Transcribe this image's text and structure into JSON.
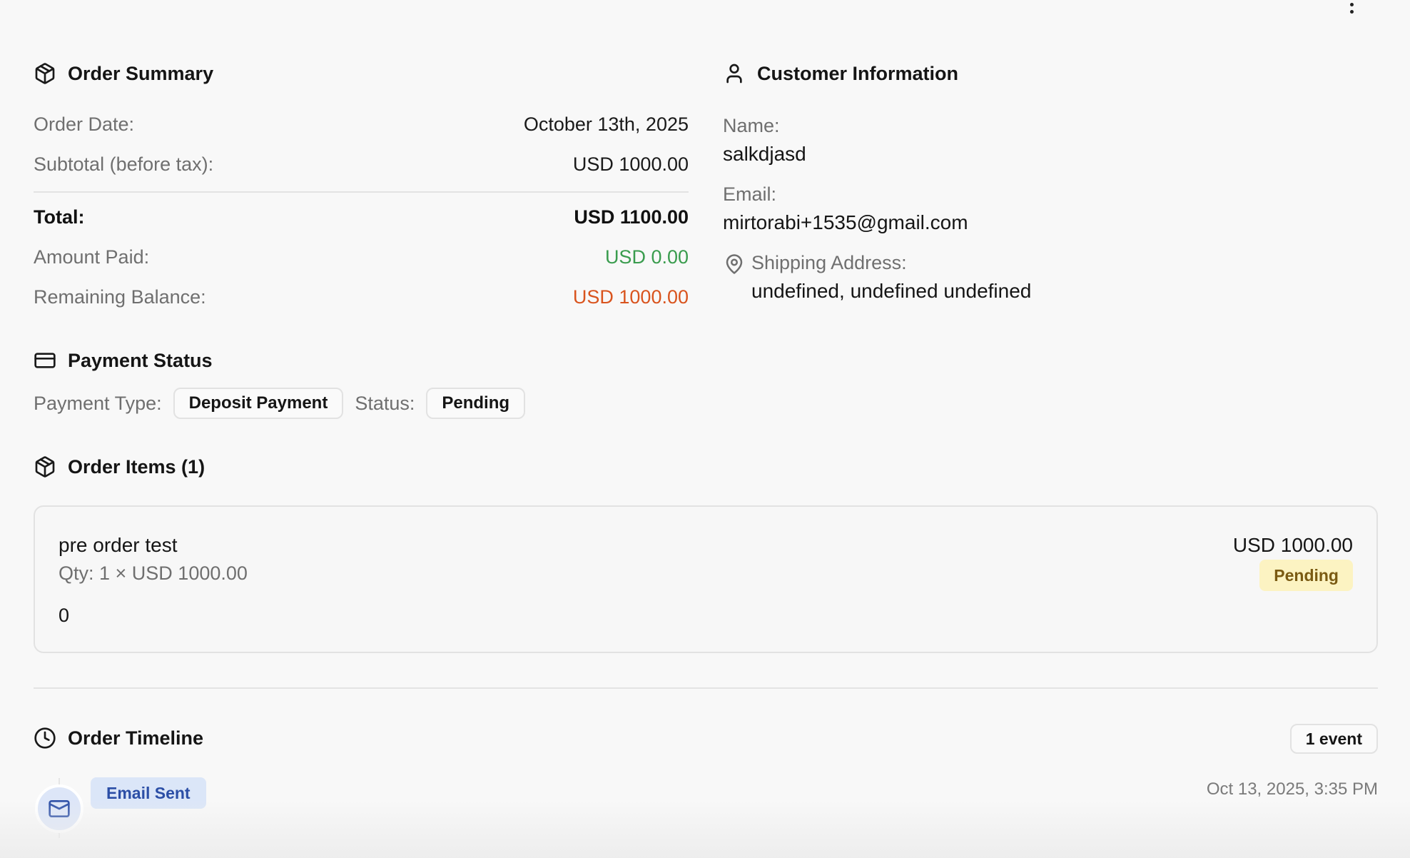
{
  "menu": {
    "icon": "more-vertical-icon"
  },
  "order_summary": {
    "title": "Order Summary",
    "icon": "package-icon",
    "rows": [
      {
        "label": "Order Date:",
        "value": "October 13th, 2025"
      },
      {
        "label": "Subtotal (before tax):",
        "value": "USD 1000.00"
      }
    ],
    "total": {
      "label": "Total:",
      "value": "USD 1100.00"
    },
    "amount_paid": {
      "label": "Amount Paid:",
      "value": "USD 0.00"
    },
    "remaining": {
      "label": "Remaining Balance:",
      "value": "USD 1000.00"
    },
    "colors": {
      "paid": "#3a9c4e",
      "remaining": "#d9541e"
    }
  },
  "customer": {
    "title": "Customer Information",
    "icon": "user-icon",
    "name_label": "Name:",
    "name": "salkdjasd",
    "email_label": "Email:",
    "email": "mirtorabi+1535@gmail.com",
    "address_icon": "map-pin-icon",
    "address_label": "Shipping Address:",
    "address": "undefined, undefined undefined"
  },
  "payment": {
    "title": "Payment Status",
    "icon": "credit-card-icon",
    "type_label": "Payment Type:",
    "type_value": "Deposit Payment",
    "status_label": "Status:",
    "status_value": "Pending"
  },
  "items": {
    "title": "Order Items (1)",
    "icon": "package-icon",
    "list": [
      {
        "name": "pre order test",
        "qty": "Qty: 1 × USD 1000.00",
        "extra": "0",
        "price": "USD 1000.00",
        "status": "Pending",
        "status_color": "#fcf3c2"
      }
    ]
  },
  "timeline": {
    "title": "Order Timeline",
    "icon": "clock-icon",
    "count": "1 event",
    "events": [
      {
        "icon": "mail-icon",
        "label": "Email Sent",
        "date": "Oct 13, 2025, 3:35 PM",
        "color": "#2b4ea6"
      }
    ]
  }
}
